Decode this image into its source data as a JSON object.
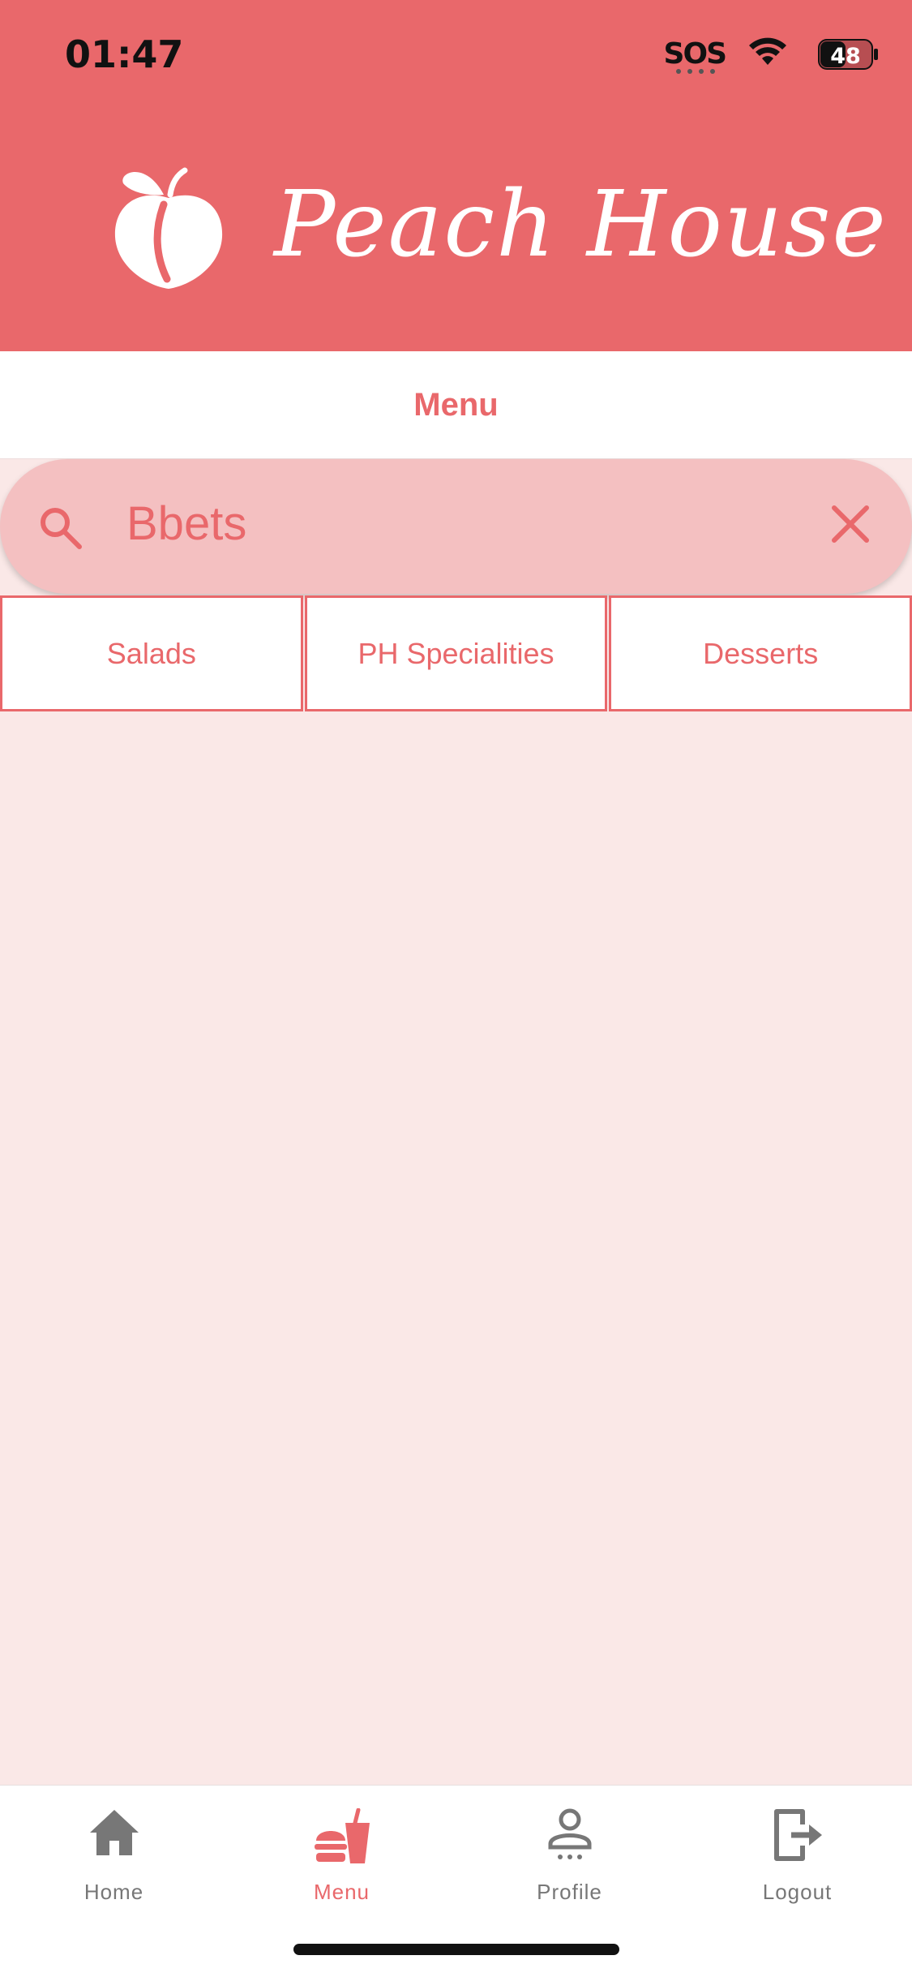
{
  "status_bar": {
    "time": "01:47",
    "sos": "SOS",
    "battery": "48",
    "wifi_icon": "wifi-icon",
    "battery_icon": "battery-icon"
  },
  "header": {
    "brand": "Peach House",
    "logo_icon": "peach-icon",
    "background_color": "#E9686B"
  },
  "page": {
    "title": "Menu"
  },
  "search": {
    "value": "Bbets",
    "search_icon": "search-icon",
    "clear_icon": "close-icon"
  },
  "categories": [
    {
      "label": "Salads"
    },
    {
      "label": "PH Specialities"
    },
    {
      "label": "Desserts"
    }
  ],
  "bottom_nav": {
    "items": [
      {
        "label": "Home",
        "icon": "home-icon",
        "active": false
      },
      {
        "label": "Menu",
        "icon": "food-icon",
        "active": true
      },
      {
        "label": "Profile",
        "icon": "profile-icon",
        "active": false
      },
      {
        "label": "Logout",
        "icon": "logout-icon",
        "active": false
      }
    ]
  },
  "colors": {
    "accent": "#E9686B",
    "search_bg": "#F4C0C1",
    "page_bg": "#FAE8E7",
    "inactive": "#777777"
  }
}
